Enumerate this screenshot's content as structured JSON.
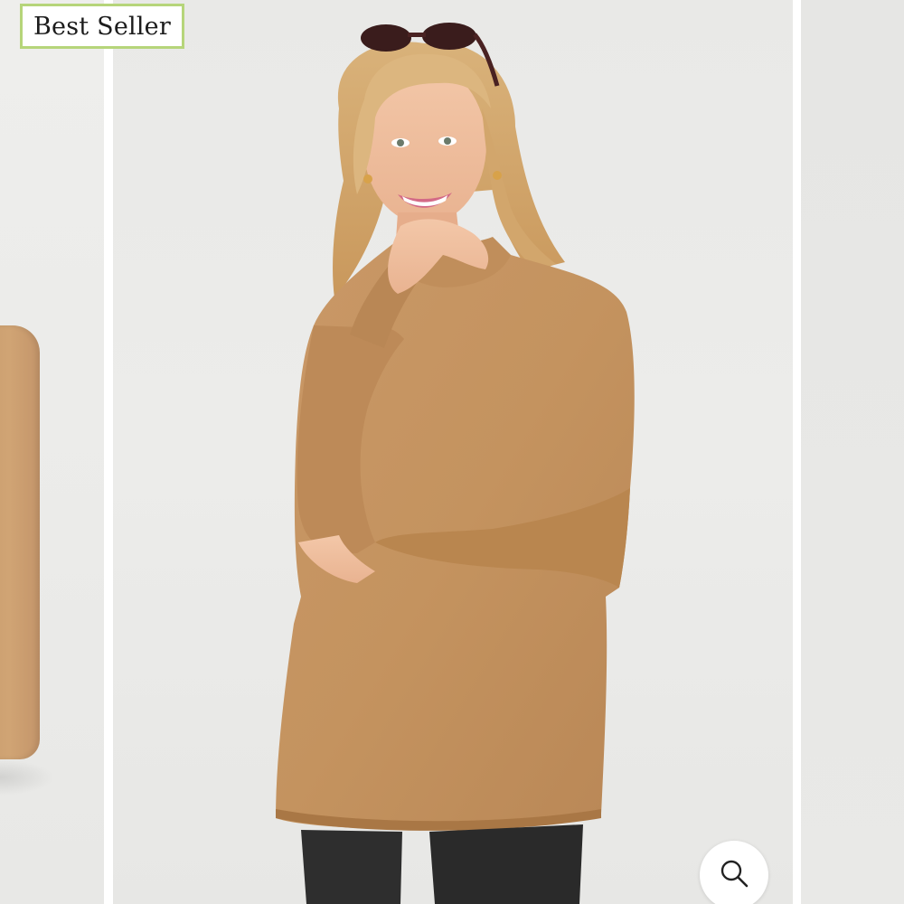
{
  "carousel": {
    "badge": {
      "label": "Best Seller",
      "border_color": "#b6d57a"
    },
    "zoom_button": {
      "icon": "magnifier-icon"
    },
    "main_image": {
      "garment_color": "#c4935f",
      "background_color": "#eaeae8"
    }
  }
}
